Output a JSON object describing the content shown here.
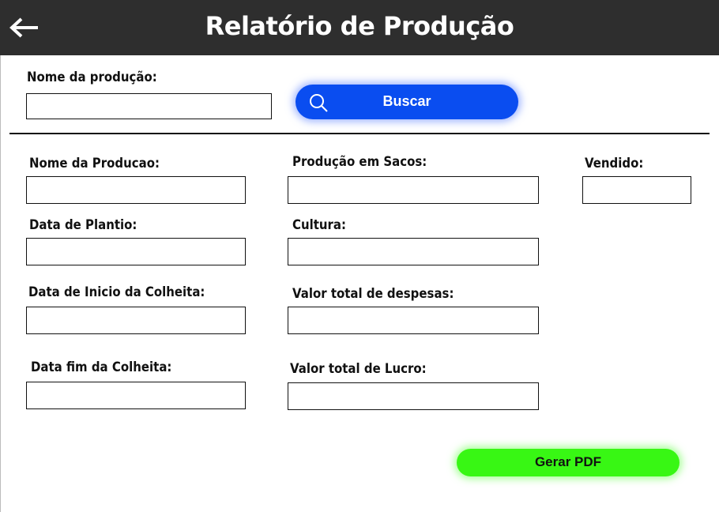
{
  "header": {
    "title": "Relatório de Produção",
    "background": "#2e2e2e"
  },
  "search": {
    "label": "Nome da produção:",
    "value": "",
    "button_label": "Buscar",
    "button_color": "#0a4df0"
  },
  "form": {
    "nome_producao": {
      "label": "Nome da Producao:",
      "value": ""
    },
    "producao_sacos": {
      "label": "Produção em Sacos:",
      "value": ""
    },
    "vendido": {
      "label": "Vendido:",
      "value": ""
    },
    "data_plantio": {
      "label": "Data de Plantio:",
      "value": ""
    },
    "cultura": {
      "label": "Cultura:",
      "value": ""
    },
    "data_inicio_colheita": {
      "label": "Data de Inicio da Colheita:",
      "value": ""
    },
    "valor_despesas": {
      "label": "Valor total de despesas:",
      "value": ""
    },
    "data_fim_colheita": {
      "label": "Data fim da Colheita:",
      "value": ""
    },
    "valor_lucro": {
      "label": "Valor total de Lucro:",
      "value": ""
    }
  },
  "actions": {
    "pdf_label": "Gerar PDF",
    "pdf_color": "#38f714"
  }
}
